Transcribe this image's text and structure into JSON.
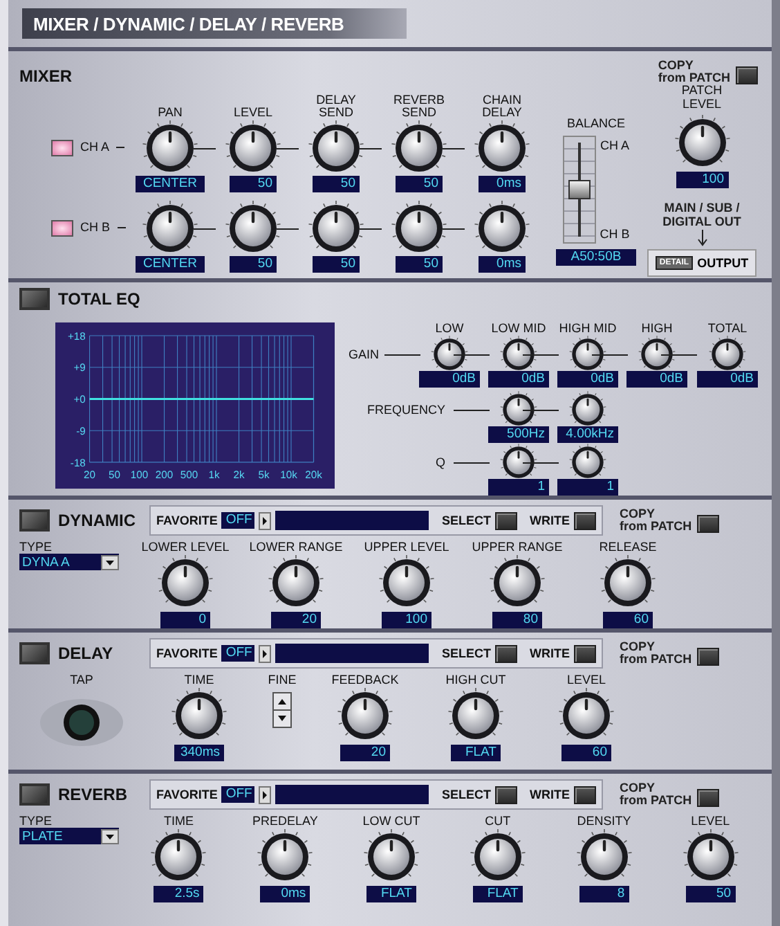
{
  "title": "MIXER / DYNAMIC / DELAY / REVERB",
  "mixer": {
    "heading": "MIXER",
    "copy": "COPY\nfrom PATCH",
    "columns": [
      "PAN",
      "LEVEL",
      "DELAY SEND",
      "REVERB SEND",
      "CHAIN DELAY"
    ],
    "channels": [
      {
        "label": "CH A",
        "on": true,
        "knobs": [
          {
            "value": "CENTER"
          },
          {
            "value": "50"
          },
          {
            "value": "50"
          },
          {
            "value": "50"
          },
          {
            "value": "0ms"
          }
        ]
      },
      {
        "label": "CH B",
        "on": true,
        "knobs": [
          {
            "value": "CENTER"
          },
          {
            "value": "50"
          },
          {
            "value": "50"
          },
          {
            "value": "50"
          },
          {
            "value": "0ms"
          }
        ]
      }
    ],
    "balance": {
      "label": "BALANCE",
      "top": "CH A",
      "bottom": "CH B",
      "level": 0.5,
      "value": "A50:50B"
    },
    "patch_level": {
      "label": "PATCH LEVEL",
      "value": "100"
    },
    "output_note": "MAIN / SUB / DIGITAL OUT",
    "detail": "DETAIL",
    "output": "OUTPUT"
  },
  "eq": {
    "heading": "TOTAL EQ",
    "on": false,
    "chart_data": {
      "type": "line",
      "categories": [
        "20",
        "50",
        "100",
        "200",
        "500",
        "1k",
        "2k",
        "5k",
        "10k",
        "20k"
      ],
      "grid": true,
      "series": [
        {
          "color": "#40e0e0",
          "values": [
            0,
            0,
            0,
            0,
            0,
            0,
            0,
            0,
            0,
            0
          ]
        }
      ],
      "ylim": [
        -18,
        18
      ],
      "yticks": [
        {
          "value": 18,
          "label": "+18"
        },
        {
          "value": 9,
          "label": "+9"
        },
        {
          "value": 0,
          "label": "+0"
        },
        {
          "value": -9,
          "label": "-9"
        },
        {
          "value": -18,
          "label": "-18"
        }
      ]
    },
    "bands": [
      "LOW",
      "LOW MID",
      "HIGH MID",
      "HIGH",
      "TOTAL"
    ],
    "gain_label": "GAIN",
    "gain": [
      {
        "value": "0dB"
      },
      {
        "value": "0dB"
      },
      {
        "value": "0dB"
      },
      {
        "value": "0dB"
      },
      {
        "value": "0dB"
      }
    ],
    "frequency_label": "FREQUENCY",
    "frequency": [
      {
        "value": "500Hz"
      },
      {
        "value": "4.00kHz"
      }
    ],
    "q_label": "Q",
    "q": [
      {
        "value": "1"
      },
      {
        "value": "1"
      }
    ]
  },
  "effects": [
    {
      "heading": "DYNAMIC",
      "on": false,
      "favorite": {
        "label": "FAVORITE",
        "value": "OFF"
      },
      "select": "SELECT",
      "write": "WRITE",
      "copy": "COPY\nfrom PATCH",
      "controls": [
        {
          "kind": "select",
          "label": "TYPE",
          "value": "DYNA A"
        },
        {
          "kind": "knob",
          "label": "LOWER LEVEL",
          "value": "0"
        },
        {
          "kind": "knob",
          "label": "LOWER RANGE",
          "value": "20"
        },
        {
          "kind": "knob",
          "label": "UPPER LEVEL",
          "value": "100"
        },
        {
          "kind": "knob",
          "label": "UPPER RANGE",
          "value": "80"
        },
        {
          "kind": "knob",
          "label": "RELEASE",
          "value": "60"
        }
      ]
    },
    {
      "heading": "DELAY",
      "on": false,
      "favorite": {
        "label": "FAVORITE",
        "value": "OFF"
      },
      "select": "SELECT",
      "write": "WRITE",
      "copy": "COPY\nfrom PATCH",
      "controls": [
        {
          "kind": "tap",
          "label": "TAP"
        },
        {
          "kind": "knob",
          "label": "TIME",
          "value": "340ms"
        },
        {
          "kind": "stepper",
          "label": "FINE"
        },
        {
          "kind": "knob",
          "label": "FEEDBACK",
          "value": "20"
        },
        {
          "kind": "knob",
          "label": "HIGH CUT",
          "value": "FLAT"
        },
        {
          "kind": "knob",
          "label": "LEVEL",
          "value": "60"
        }
      ]
    },
    {
      "heading": "REVERB",
      "on": false,
      "favorite": {
        "label": "FAVORITE",
        "value": "OFF"
      },
      "select": "SELECT",
      "write": "WRITE",
      "copy": "COPY\nfrom PATCH",
      "controls": [
        {
          "kind": "select",
          "label": "TYPE",
          "value": "PLATE"
        },
        {
          "kind": "knob",
          "label": "TIME",
          "value": "2.5s"
        },
        {
          "kind": "knob",
          "label": "PREDELAY",
          "value": "0ms"
        },
        {
          "kind": "knob",
          "label": "LOW CUT",
          "value": "FLAT"
        },
        {
          "kind": "knob",
          "label": "CUT",
          "value": "FLAT"
        },
        {
          "kind": "knob",
          "label": "DENSITY",
          "value": "8"
        },
        {
          "kind": "knob",
          "label": "LEVEL",
          "value": "50"
        }
      ]
    }
  ]
}
